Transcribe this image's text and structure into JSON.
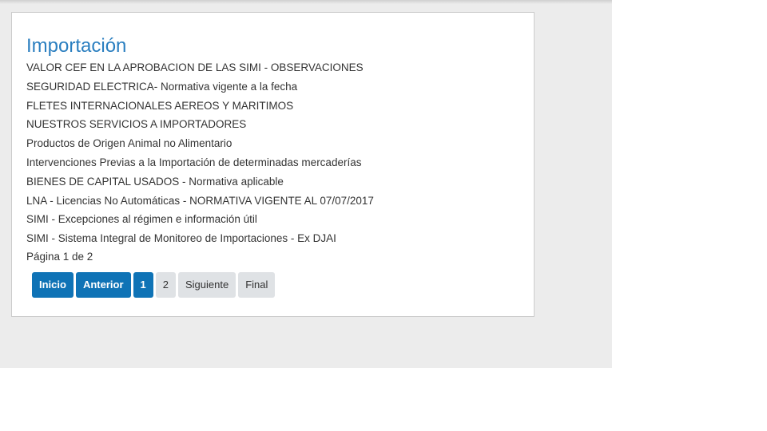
{
  "colors": {
    "title": "#2b7fc0",
    "primary_button": "#0f73b6",
    "secondary_button": "#dfe2e5",
    "page_background": "#ececec",
    "text": "#333333"
  },
  "panel": {
    "title": "Importación",
    "items": [
      "VALOR CEF EN LA APROBACION DE LAS SIMI - OBSERVACIONES",
      "SEGURIDAD ELECTRICA- Normativa vigente a la fecha",
      "FLETES INTERNACIONALES AEREOS Y MARITIMOS",
      "NUESTROS SERVICIOS A IMPORTADORES",
      "Productos de Origen Animal no Alimentario",
      "Intervenciones Previas a la Importación de determinadas mercaderías",
      "BIENES DE CAPITAL USADOS - Normativa aplicable",
      "LNA - Licencias No Automáticas - NORMATIVA VIGENTE AL 07/07/2017",
      "SIMI - Excepciones al régimen e información útil",
      "SIMI - Sistema Integral de Monitoreo de Importaciones - Ex DJAI"
    ],
    "page_info": "Página 1 de 2"
  },
  "pagination": {
    "first": "Inicio",
    "prev": "Anterior",
    "pages": [
      "1",
      "2"
    ],
    "next": "Siguiente",
    "last": "Final",
    "current_page": 1
  }
}
